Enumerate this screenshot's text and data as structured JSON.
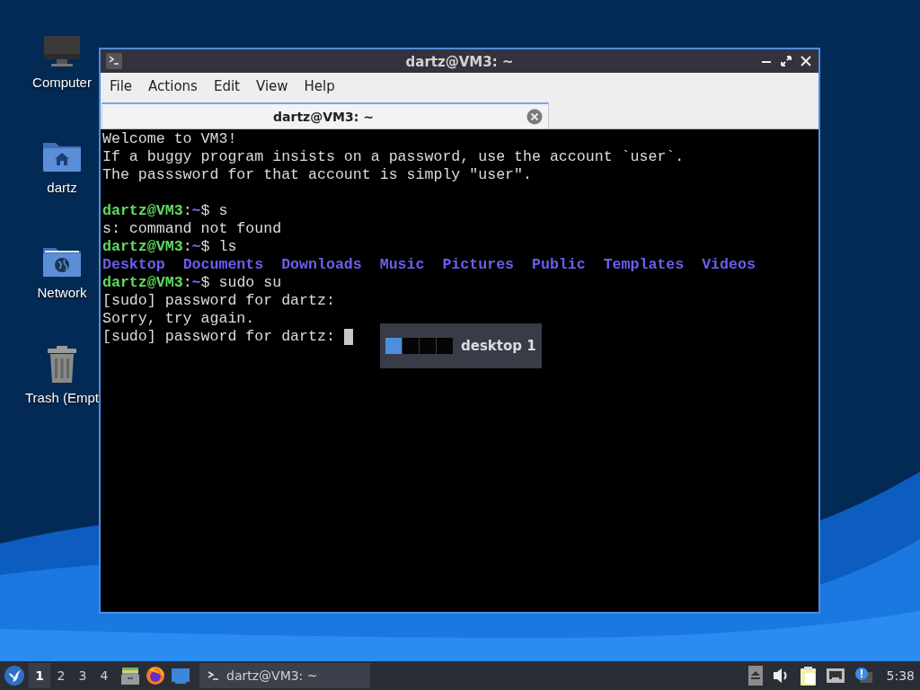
{
  "desktop": {
    "icons": [
      {
        "label": "Computer",
        "kind": "computer"
      },
      {
        "label": "dartz",
        "kind": "home"
      },
      {
        "label": "Network",
        "kind": "network"
      },
      {
        "label": "Trash (Empt",
        "kind": "trash"
      }
    ]
  },
  "window": {
    "title": "dartz@VM3: ~",
    "menu": [
      "File",
      "Actions",
      "Edit",
      "View",
      "Help"
    ],
    "tabs": [
      {
        "label": "dartz@VM3: ~",
        "selected": true
      }
    ],
    "terminal": {
      "lines": [
        {
          "blank_before": false,
          "cursor": false,
          "segments": [
            {
              "kind": "text",
              "text": "Welcome to VM3!"
            }
          ]
        },
        {
          "blank_before": false,
          "cursor": false,
          "segments": [
            {
              "kind": "text",
              "text": "If a buggy program insists on a password, use the account `user`."
            }
          ]
        },
        {
          "blank_before": false,
          "cursor": false,
          "segments": [
            {
              "kind": "text",
              "text": "The passsword for that account is simply \"user\"."
            }
          ]
        },
        {
          "blank_before": true,
          "cursor": false,
          "segments": [
            {
              "kind": "user",
              "text": "dartz@VM3"
            },
            {
              "kind": "text",
              "text": ":"
            },
            {
              "kind": "path",
              "text": "~"
            },
            {
              "kind": "text",
              "text": "$ s"
            }
          ]
        },
        {
          "blank_before": false,
          "cursor": false,
          "segments": [
            {
              "kind": "text",
              "text": "s: command not found"
            }
          ]
        },
        {
          "blank_before": false,
          "cursor": false,
          "segments": [
            {
              "kind": "user",
              "text": "dartz@VM3"
            },
            {
              "kind": "text",
              "text": ":"
            },
            {
              "kind": "path",
              "text": "~"
            },
            {
              "kind": "text",
              "text": "$ ls"
            }
          ]
        },
        {
          "blank_before": false,
          "cursor": false,
          "segments": [
            {
              "kind": "dir",
              "text": "Desktop"
            },
            {
              "kind": "dir",
              "text": "Documents"
            },
            {
              "kind": "dir",
              "text": "Downloads"
            },
            {
              "kind": "dir",
              "text": "Music"
            },
            {
              "kind": "dir",
              "text": "Pictures"
            },
            {
              "kind": "dir",
              "text": "Public"
            },
            {
              "kind": "dir",
              "text": "Templates"
            },
            {
              "kind": "dir",
              "text": "Videos"
            }
          ]
        },
        {
          "blank_before": false,
          "cursor": false,
          "segments": [
            {
              "kind": "user",
              "text": "dartz@VM3"
            },
            {
              "kind": "text",
              "text": ":"
            },
            {
              "kind": "path",
              "text": "~"
            },
            {
              "kind": "text",
              "text": "$ sudo su"
            }
          ]
        },
        {
          "blank_before": false,
          "cursor": false,
          "segments": [
            {
              "kind": "text",
              "text": "[sudo] password for dartz:"
            }
          ]
        },
        {
          "blank_before": false,
          "cursor": false,
          "segments": [
            {
              "kind": "text",
              "text": "Sorry, try again."
            }
          ]
        },
        {
          "blank_before": false,
          "cursor": true,
          "segments": [
            {
              "kind": "text",
              "text": "[sudo] password for dartz:"
            }
          ]
        }
      ]
    }
  },
  "pager_popup": {
    "workspaces": [
      {
        "selected": true
      },
      {
        "selected": false
      },
      {
        "selected": false
      },
      {
        "selected": false
      }
    ],
    "label": "desktop 1"
  },
  "taskbar": {
    "workspaces": [
      {
        "label": "1",
        "selected": true
      },
      {
        "label": "2",
        "selected": false
      },
      {
        "label": "3",
        "selected": false
      },
      {
        "label": "4",
        "selected": false
      }
    ],
    "tasks": [
      {
        "label": "dartz@VM3: ~",
        "selected": true
      }
    ],
    "clock": "5:38"
  }
}
